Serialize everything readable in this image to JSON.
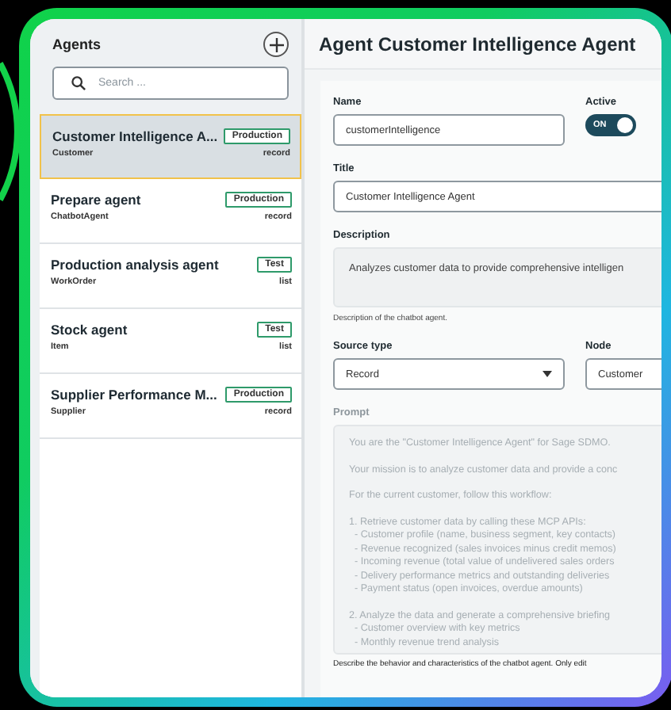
{
  "sidebar": {
    "title": "Agents",
    "search": {
      "placeholder": "Search ..."
    },
    "items": [
      {
        "title": "Customer Intelligence A...",
        "entity": "Customer",
        "status": "Production",
        "mode": "record",
        "selected": true
      },
      {
        "title": "Prepare agent",
        "entity": "ChatbotAgent",
        "status": "Production",
        "mode": "record",
        "selected": false
      },
      {
        "title": "Production analysis agent",
        "entity": "WorkOrder",
        "status": "Test",
        "mode": "list",
        "selected": false
      },
      {
        "title": "Stock agent",
        "entity": "Item",
        "status": "Test",
        "mode": "list",
        "selected": false
      },
      {
        "title": "Supplier Performance M...",
        "entity": "Supplier",
        "status": "Production",
        "mode": "record",
        "selected": false
      }
    ]
  },
  "detail": {
    "title": "Agent Customer Intelligence Agent",
    "name": {
      "label": "Name",
      "value": "customerIntelligence"
    },
    "active": {
      "label": "Active",
      "on": true,
      "text": "ON"
    },
    "title_field": {
      "label": "Title",
      "value": "Customer Intelligence Agent"
    },
    "description": {
      "label": "Description",
      "value": "Analyzes customer data to provide comprehensive intelligen",
      "help": "Description of the chatbot agent."
    },
    "source_type": {
      "label": "Source type",
      "value": "Record"
    },
    "node": {
      "label": "Node",
      "value": "Customer"
    },
    "prompt": {
      "label": "Prompt",
      "disabled": true,
      "paragraphs": [
        [
          "You are the \"Customer Intelligence Agent\" for Sage SDMO."
        ],
        [
          "Your mission is to analyze customer data and provide a conc"
        ],
        [
          "For the current customer, follow this workflow:"
        ],
        [
          "1. Retrieve customer data by calling these MCP APIs:",
          "  - Customer profile (name, business segment, key contacts)",
          "  - Revenue recognized (sales invoices minus credit memos)",
          "  - Incoming revenue (total value of undelivered sales orders",
          "  - Delivery performance metrics and outstanding deliveries",
          "  - Payment status (open invoices, overdue amounts)"
        ],
        [
          "2. Analyze the data and generate a comprehensive briefing",
          "  - Customer overview with key metrics",
          "  - Monthly revenue trend analysis"
        ]
      ],
      "help": "Describe the behavior and characteristics of the chatbot agent. Only edit"
    }
  }
}
